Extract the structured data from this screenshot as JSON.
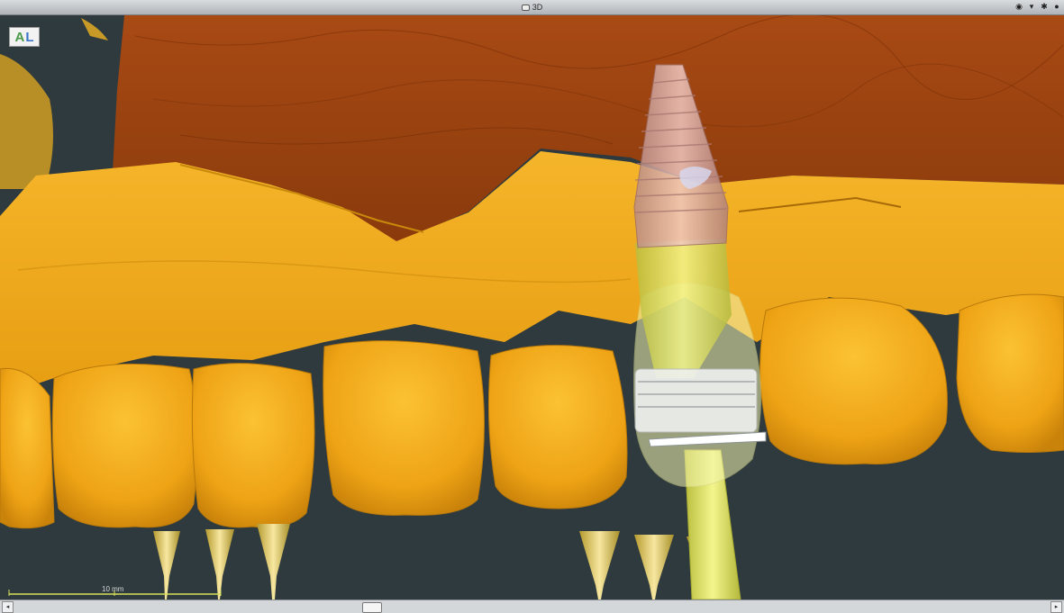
{
  "window": {
    "title": "3D"
  },
  "title_controls": [
    {
      "name": "eye-icon",
      "glyph": "◉"
    },
    {
      "name": "chevron-down-icon",
      "glyph": "▾"
    },
    {
      "name": "settings-icon",
      "glyph": "✱"
    },
    {
      "name": "close-icon",
      "glyph": "●"
    }
  ],
  "viewport": {
    "orientation": {
      "a": "A",
      "l": "L"
    },
    "scale_bar": {
      "label": "10 mm"
    }
  },
  "scrollbar": {
    "left_arrow": "◂",
    "right_arrow": "▸"
  },
  "colors": {
    "background": "#2e3a3d",
    "bone": "#9c4412",
    "gingiva": "#f3b21e",
    "implant": "#d9a8a0",
    "guide_sleeve": "#e6eb6a"
  }
}
